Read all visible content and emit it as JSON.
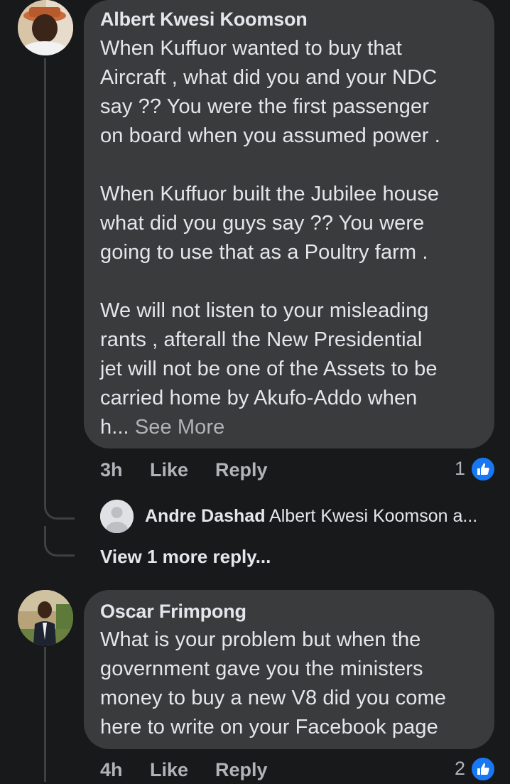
{
  "comments": [
    {
      "author": "Albert Kwesi Koomson",
      "text": "When Kuffuor wanted to buy that\nAircraft , what did you and your NDC\nsay ?? You were the first passenger\non board when you assumed power .\n\nWhen Kuffuor built the Jubilee house\nwhat did you guys say ?? You were\ngoing to use that as a Poultry farm .\n\nWe will not listen to your misleading\nrants , afterall the New Presidential\njet will not be one of the Assets to be\ncarried home by Akufo-Addo when\nh...",
      "see_more": " See More",
      "time": "3h",
      "like_label": "Like",
      "reply_label": "Reply",
      "reaction_count": "1"
    },
    {
      "author": "Oscar Frimpong",
      "text": "What is your problem but when the\ngovernment gave you the ministers\nmoney to buy a new V8 did you come\nhere to write on your Facebook page",
      "time": "4h",
      "like_label": "Like",
      "reply_label": "Reply",
      "reaction_count": "2"
    }
  ],
  "reply_preview": {
    "author": "Andre Dashad",
    "text": "Albert Kwesi Koomson a..."
  },
  "view_more_replies": "View 1 more reply...",
  "colors": {
    "background": "#18191a",
    "bubble": "#3a3b3c",
    "like_blue": "#1877f2",
    "secondary_text": "#b0b3b8"
  }
}
